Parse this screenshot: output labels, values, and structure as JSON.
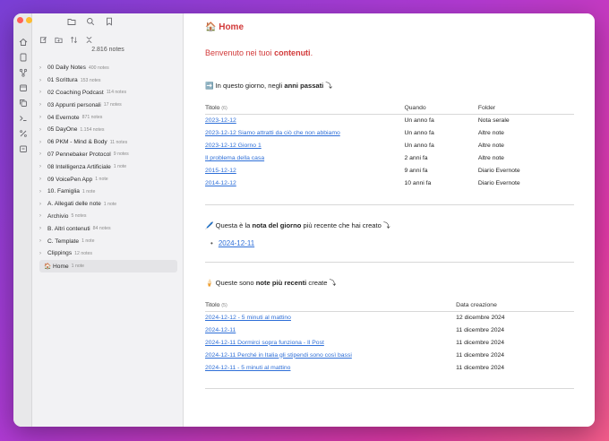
{
  "window": {
    "title": "Home"
  },
  "sidebar": {
    "note_count": "2.816 notes",
    "items": [
      {
        "label": "00 Daily Notes",
        "count": "400 notes",
        "folder": true
      },
      {
        "label": "01 Scrittura",
        "count": "153 notes",
        "folder": true
      },
      {
        "label": "02 Coaching Podcast",
        "count": "114 notes",
        "folder": true
      },
      {
        "label": "03 Appunti personali",
        "count": "17 notes",
        "folder": true
      },
      {
        "label": "04 Evernote",
        "count": "871 notes",
        "folder": true
      },
      {
        "label": "05 DayOne",
        "count": "1.154 notes",
        "folder": true
      },
      {
        "label": "06 PKM - Mind & Body",
        "count": "11 notes",
        "folder": true
      },
      {
        "label": "07 Pennebaker Protocol",
        "count": "9 notes",
        "folder": true
      },
      {
        "label": "08 Intelligenza Artificiale",
        "count": "1 note",
        "folder": true
      },
      {
        "label": "09 VoicePen App",
        "count": "1 note",
        "folder": true
      },
      {
        "label": "10. Famiglia",
        "count": "1 note",
        "folder": true
      },
      {
        "label": "A. Allegati delle note",
        "count": "1 note",
        "folder": true
      },
      {
        "label": "Archivio",
        "count": "5 notes",
        "folder": true
      },
      {
        "label": "B. Altri contenuti",
        "count": "84 notes",
        "folder": true
      },
      {
        "label": "C. Template",
        "count": "1 note",
        "folder": true
      },
      {
        "label": "Clippings",
        "count": "12 notes",
        "folder": true
      },
      {
        "label": "🏠 Home",
        "count": "1 note",
        "folder": false,
        "active": true
      }
    ]
  },
  "main": {
    "title": "🏠 Home",
    "welcome_prefix": "Benvenuto nei tuoi ",
    "welcome_bold": "contenuti",
    "welcome_suffix": ".",
    "section1": {
      "prefix": "➡️ In questo giorno, negli ",
      "bold": "anni passati",
      "suffix": " ⤵",
      "col_title": "Titolo",
      "col_title_count": "(6)",
      "col_when": "Quando",
      "col_folder": "Folder",
      "rows": [
        {
          "title": "2023-12-12",
          "when": "Un anno fa",
          "folder": "Nota serale"
        },
        {
          "title": "2023-12-12 Siamo attratti da ciò che non abbiamo",
          "when": "Un anno fa",
          "folder": "Altre note"
        },
        {
          "title": "2023-12-12 Giorno 1",
          "when": "Un anno fa",
          "folder": "Altre note"
        },
        {
          "title": "Il problema della casa",
          "when": "2 anni fa",
          "folder": "Altre note"
        },
        {
          "title": "2015-12-12",
          "when": "9 anni fa",
          "folder": "Diario Evernote"
        },
        {
          "title": "2014-12-12",
          "when": "10 anni fa",
          "folder": "Diario Evernote"
        }
      ]
    },
    "section2": {
      "prefix": "🖊️ Questa è la ",
      "bold": "nota del giorno",
      "suffix": " più recente che hai creato ⤵",
      "items": [
        "2024-12-11"
      ]
    },
    "section3": {
      "prefix": "🍦 Queste sono ",
      "bold": "note più recenti",
      "suffix": " create ⤵",
      "col_title": "Titolo",
      "col_title_count": "(5)",
      "col_date": "Data creazione",
      "rows": [
        {
          "title": "2024-12-12 - 5 minuti al mattino",
          "date": "12 dicembre 2024"
        },
        {
          "title": "2024-12-11",
          "date": "11 dicembre 2024"
        },
        {
          "title": "2024-12-11 Dormirci sopra funziona - Il Post",
          "date": "11 dicembre 2024"
        },
        {
          "title": "2024-12-11 Perché in Italia gli stipendi sono così bassi",
          "date": "11 dicembre 2024"
        },
        {
          "title": "2024-12-11 - 5 minuti al mattino",
          "date": "11 dicembre 2024"
        }
      ]
    }
  },
  "colors": {
    "accent_red": "#d23a3a",
    "link_blue": "#2e6fd8"
  }
}
